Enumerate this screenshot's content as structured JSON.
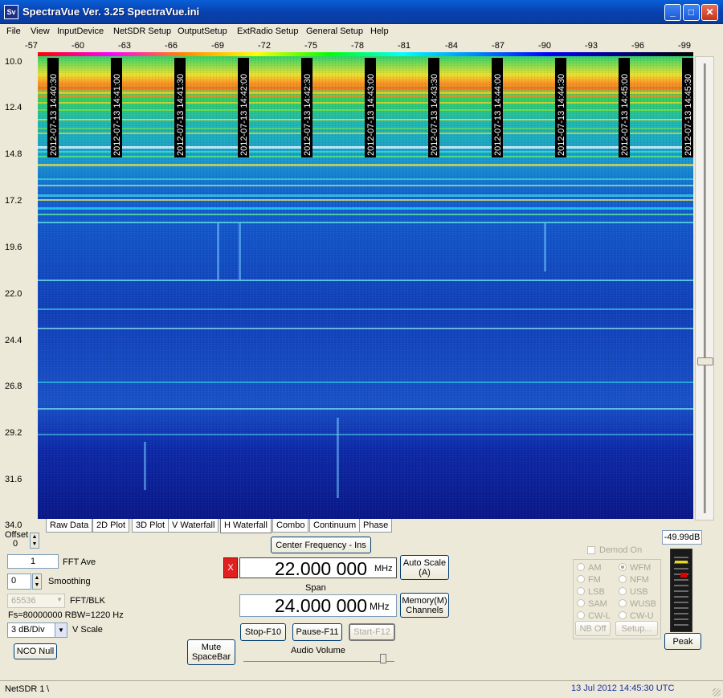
{
  "window": {
    "app_icon": "Sv",
    "title": "SpectraVue Ver. 3.25  SpectraVue.ini",
    "min_icon": "_",
    "max_icon": "□",
    "close_icon": "✕"
  },
  "menu": [
    "File",
    "View",
    "InputDevice",
    "NetSDR Setup",
    "OutputSetup",
    "ExtRadio Setup",
    "General Setup",
    "Help"
  ],
  "x_axis_ticks": [
    "-57",
    "-60",
    "-63",
    "-66",
    "-69",
    "-72",
    "-75",
    "-78",
    "-81",
    "-84",
    "-87",
    "-90",
    "-93",
    "-96",
    "-99"
  ],
  "y_axis_ticks": [
    "10.0",
    "12.4",
    "14.8",
    "17.2",
    "19.6",
    "22.0",
    "24.4",
    "26.8",
    "29.2",
    "31.6",
    "34.0"
  ],
  "timestamps": [
    "2012-07-13 14:40:30",
    "2012-07-13 14:41:00",
    "2012-07-13 14:41:30",
    "2012-07-13 14:42:00",
    "2012-07-13 14:42:30",
    "2012-07-13 14:43:00",
    "2012-07-13 14:43:30",
    "2012-07-13 14:44:00",
    "2012-07-13 14:44:30",
    "2012-07-13 14:45:00",
    "2012-07-13 14:45:30"
  ],
  "tabs": [
    "Raw Data",
    "2D Plot",
    "3D Plot",
    "V Waterfall",
    "H Waterfall",
    "Combo",
    "Continuum",
    "Phase"
  ],
  "active_tab": "H Waterfall",
  "controls": {
    "offset_label": "Offset",
    "offset_value": "0",
    "fft_ave_value": "1",
    "fft_ave_label": "FFT Ave",
    "smoothing_value": "0",
    "smoothing_label": "Smoothing",
    "fft_blk_value": "65536",
    "fft_blk_label": "FFT/BLK",
    "fs_text": "Fs=80000000 RBW=1220 Hz",
    "vscale_value": "3 dB/Div",
    "vscale_label": "V Scale",
    "nco_null": "NCO Null",
    "mute_line1": "Mute",
    "mute_line2": "SpaceBar",
    "center_freq_button": "Center Frequency - Ins",
    "red_x": "X",
    "center_freq_value": "22.000 000",
    "center_freq_unit": "MHz",
    "auto_scale_line1": "Auto Scale",
    "auto_scale_line2": "(A)",
    "span_label": "Span",
    "span_value": "24.000 000",
    "span_unit": "MHz",
    "memory_line1": "Memory(M)",
    "memory_line2": "Channels",
    "stop": "Stop-F10",
    "pause": "Pause-F11",
    "start": "Start-F12",
    "audio_volume": "Audio Volume"
  },
  "demod": {
    "checkbox_label": "Demod On",
    "modes_left": [
      "AM",
      "FM",
      "LSB",
      "SAM",
      "CW-L"
    ],
    "modes_right": [
      "WFM",
      "NFM",
      "USB",
      "WUSB",
      "CW-U"
    ],
    "nb_off": "NB Off",
    "setup": "Setup..."
  },
  "meter": {
    "readout": "-49.99dB",
    "peak_button": "Peak"
  },
  "status": {
    "device": "NetSDR 1",
    "separator": "\\",
    "datetime": "13 Jul 2012  14:45:30 UTC"
  }
}
